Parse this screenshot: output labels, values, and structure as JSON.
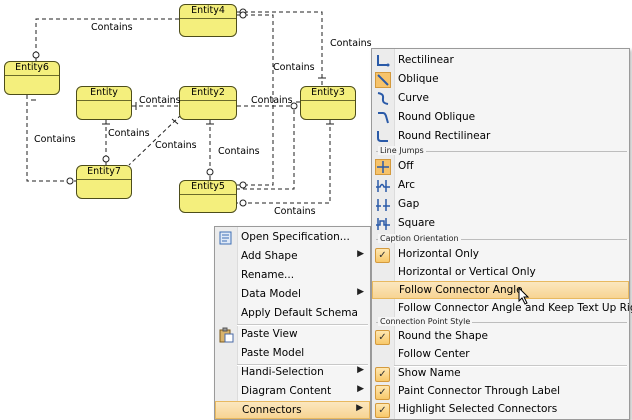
{
  "diagram": {
    "entities": {
      "entity4": "Entity4",
      "entity6": "Entity6",
      "entity": "Entity",
      "entity2": "Entity2",
      "entity3": "Entity3",
      "entity7": "Entity7",
      "entity5": "Entity5"
    },
    "relationship_label": "Contains"
  },
  "context_menu": {
    "items": [
      {
        "label": "Open Specification...",
        "icon": "specification-icon"
      },
      {
        "label": "Add Shape",
        "submenu": true
      },
      {
        "label": "Rename..."
      },
      {
        "label": "Data Model",
        "submenu": true
      },
      {
        "label": "Apply Default Schema"
      },
      {
        "label": "Paste View",
        "icon": "paste-icon"
      },
      {
        "label": "Paste Model"
      },
      {
        "label": "Handi-Selection",
        "submenu": true
      },
      {
        "label": "Diagram Content",
        "submenu": true
      },
      {
        "label": "Connectors",
        "submenu": true,
        "highlighted": true
      }
    ]
  },
  "connectors_submenu": {
    "connector_styles": [
      {
        "label": "Rectilinear",
        "icon": "rectilinear-icon"
      },
      {
        "label": "Oblique",
        "icon": "oblique-icon",
        "selected": true
      },
      {
        "label": "Curve",
        "icon": "curve-icon"
      },
      {
        "label": "Round Oblique",
        "icon": "round-oblique-icon"
      },
      {
        "label": "Round Rectilinear",
        "icon": "round-rectilinear-icon"
      }
    ],
    "line_jumps_header": "Line Jumps",
    "line_jumps": [
      {
        "label": "Off",
        "icon": "line-jump-off-icon",
        "selected": true
      },
      {
        "label": "Arc",
        "icon": "line-jump-arc-icon"
      },
      {
        "label": "Gap",
        "icon": "line-jump-gap-icon"
      },
      {
        "label": "Square",
        "icon": "line-jump-square-icon"
      }
    ],
    "caption_orientation_header": "Caption Orientation",
    "caption_orientation": [
      {
        "label": "Horizontal Only",
        "checked": true
      },
      {
        "label": "Horizontal or Vertical Only"
      },
      {
        "label": "Follow Connector Angle",
        "highlighted": true
      },
      {
        "label": "Follow Connector Angle and Keep Text Up Right"
      }
    ],
    "connection_point_header": "Connection Point Style",
    "connection_point_style": [
      {
        "label": "Round the Shape",
        "checked": true
      },
      {
        "label": "Follow Center"
      }
    ],
    "options": [
      {
        "label": "Show Name",
        "checked": true
      },
      {
        "label": "Paint Connector Through Label",
        "checked": true
      },
      {
        "label": "Highlight Selected Connectors",
        "checked": true
      }
    ]
  }
}
